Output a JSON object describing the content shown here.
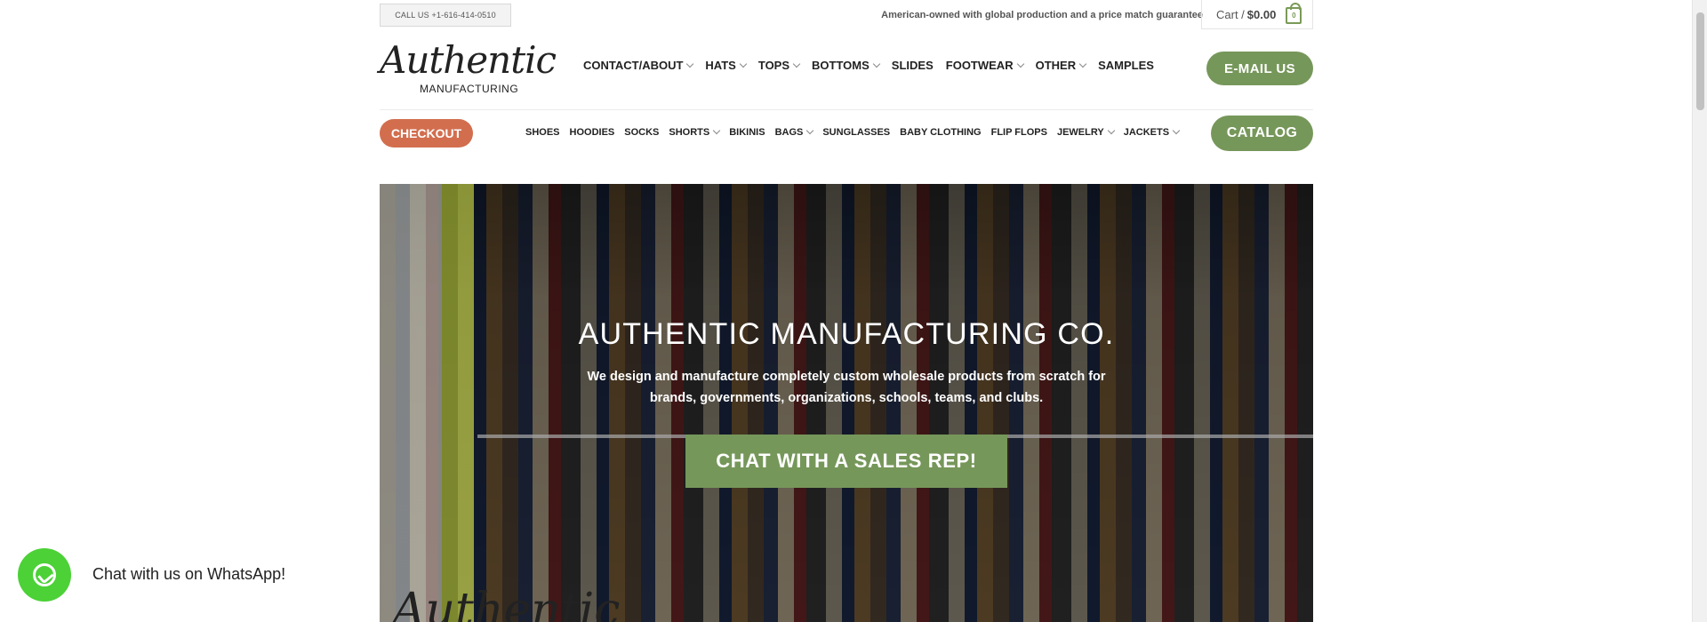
{
  "topbar": {
    "call_us": "CALL US +1-616-414-0510",
    "tagline": "American-owned with global production and a price match guarantee",
    "cart_label": "Cart /",
    "cart_total": "$0.00",
    "cart_count": "0"
  },
  "logo": {
    "script": "Authentic",
    "sub": "MANUFACTURING"
  },
  "main_nav": {
    "items": [
      {
        "label": "CONTACT/ABOUT",
        "dropdown": true
      },
      {
        "label": "HATS",
        "dropdown": true
      },
      {
        "label": "TOPS",
        "dropdown": true
      },
      {
        "label": "BOTTOMS",
        "dropdown": true
      },
      {
        "label": "SLIDES",
        "dropdown": false
      },
      {
        "label": "FOOTWEAR",
        "dropdown": true
      },
      {
        "label": "OTHER",
        "dropdown": true
      },
      {
        "label": "SAMPLES",
        "dropdown": false
      }
    ],
    "email_button": "E-MAIL US"
  },
  "sub_nav": {
    "checkout": "CHECKOUT",
    "items": [
      {
        "label": "SHOES",
        "dropdown": false
      },
      {
        "label": "HOODIES",
        "dropdown": false
      },
      {
        "label": "SOCKS",
        "dropdown": false
      },
      {
        "label": "SHORTS",
        "dropdown": true
      },
      {
        "label": "BIKINIS",
        "dropdown": false
      },
      {
        "label": "BAGS",
        "dropdown": true
      },
      {
        "label": "SUNGLASSES",
        "dropdown": false
      },
      {
        "label": "BABY CLOTHING",
        "dropdown": false
      },
      {
        "label": "FLIP FLOPS",
        "dropdown": false
      },
      {
        "label": "JEWELRY",
        "dropdown": true
      },
      {
        "label": "JACKETS",
        "dropdown": true
      }
    ],
    "catalog": "CATALOG"
  },
  "hero": {
    "title": "AUTHENTIC MANUFACTURING CO.",
    "description_line1": "We design and manufacture completely custom wholesale products from scratch for",
    "description_line2": "brands, governments, organizations, schools, teams, and clubs.",
    "cta": "CHAT WITH A SALES REP!",
    "bottom_script": "Authentic"
  },
  "whatsapp": {
    "icon": "whatsapp-icon",
    "label": "Chat with us on WhatsApp!"
  },
  "colors": {
    "accent_green": "#76975a",
    "checkout_orange": "#d26e4e",
    "whatsapp_green": "#4cd137"
  }
}
